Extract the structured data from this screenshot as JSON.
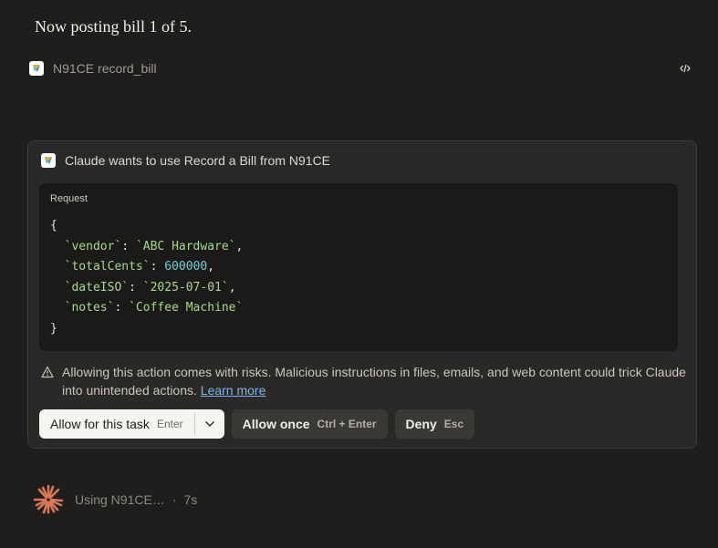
{
  "heading": "Now posting bill 1 of 5.",
  "tool_call": {
    "server": "N91CE",
    "function": "record_bill"
  },
  "permission_card": {
    "title": "Claude wants to use Record a Bill from N91CE",
    "request_label": "Request",
    "request": {
      "open_brace": "{",
      "close_brace": "}",
      "fields": [
        {
          "key": "`vendor`",
          "value": "`ABC Hardware`",
          "type": "string"
        },
        {
          "key": "`totalCents`",
          "value": "600000",
          "type": "number"
        },
        {
          "key": "`dateISO`",
          "value": "`2025-07-01`",
          "type": "string"
        },
        {
          "key": "`notes`",
          "value": "`Coffee Machine`",
          "type": "string"
        }
      ]
    },
    "warning_text": "Allowing this action comes with risks. Malicious instructions in files, emails, and web content could trick Claude into unintended actions.",
    "learn_more": "Learn more",
    "buttons": {
      "allow_task": {
        "label": "Allow for this task",
        "hint": "Enter"
      },
      "allow_once": {
        "label": "Allow once",
        "hint": "Ctrl + Enter"
      },
      "deny": {
        "label": "Deny",
        "hint": "Esc"
      }
    }
  },
  "status": {
    "text": "Using N91CE…",
    "separator": "·",
    "elapsed": "7s"
  },
  "colors": {
    "background": "#1f1e1d",
    "card": "#2a2927",
    "string": "#a6da88",
    "number": "#62d4e0",
    "link": "#7fb2f0",
    "spark": "#d97757"
  },
  "icons": [
    "n91ce-logo-icon",
    "code-icon",
    "warning-icon",
    "chevron-down-icon",
    "claude-spark-icon"
  ]
}
